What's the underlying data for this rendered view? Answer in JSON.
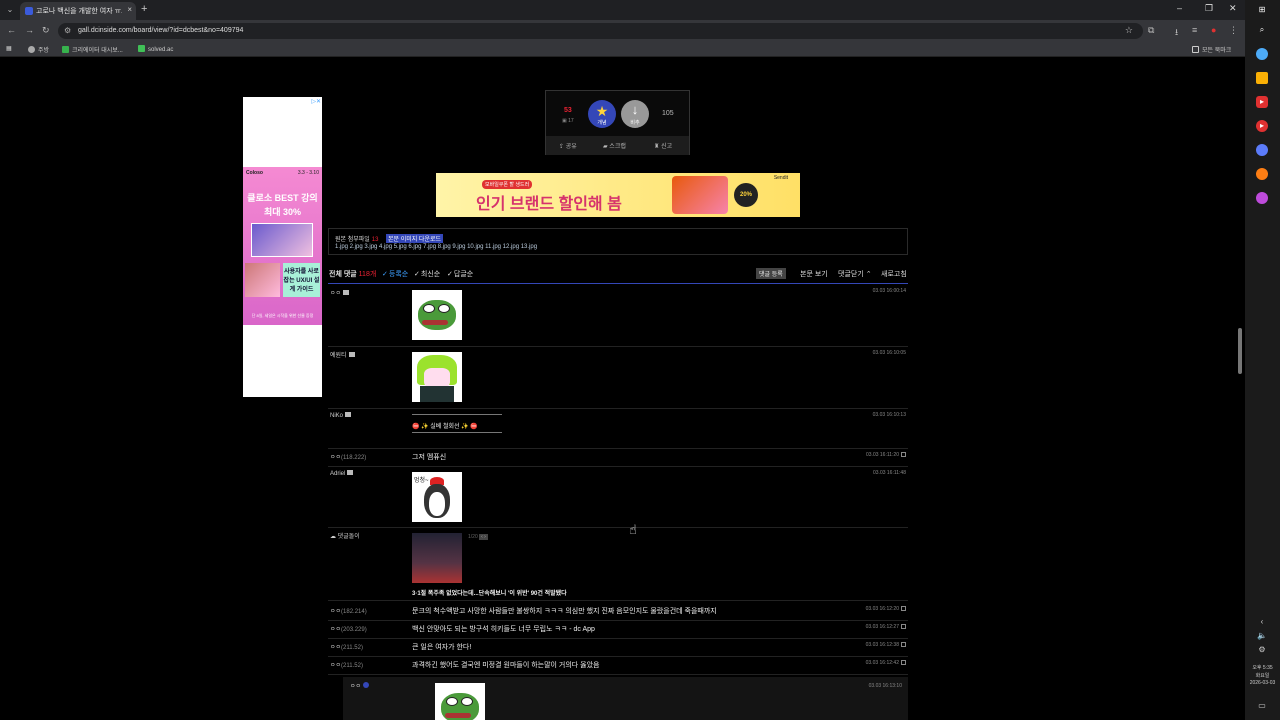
{
  "browser": {
    "tab_title": "고로나 백신을 개발한 여자 ㅠ...",
    "url": "gall.dcinside.com/board/view/?id=dcbest&no=409794",
    "bookmarks": [
      "주방",
      "크리에이터 대시보...",
      "solved.ac"
    ],
    "all_bookmarks": "모든 북마크"
  },
  "sidebar_clock": {
    "time": "오후 5:35",
    "day": "화요일",
    "date": "2026-03-03"
  },
  "side_ad": {
    "brand": "Coloso",
    "dates": "3.3 - 3.10",
    "line1": "클로소 BEST 강의",
    "line2": "최대 30%",
    "box_text": "사용자를 사로잡는 UX/UI 설계 가이드",
    "foot": "단 8일, 세일은 시작을 위한 선물 증정"
  },
  "recommend": {
    "up_count": "53",
    "fixed_count": "17",
    "up_label": "개념",
    "down_label": "비추",
    "down_count": "105",
    "share": "공유",
    "scrap": "스크랩",
    "report": "신고"
  },
  "mid_ad": {
    "tag": "모바일쿠폰 할 생드러",
    "headline": "인기 브랜드 할인해 봄",
    "logo": "Sendit",
    "badge": "20%"
  },
  "files": {
    "label": "원본 첨부파일",
    "count": "13",
    "download": "본문 이미지 다운로드",
    "list": "1.jpg  2.jpg  3.jpg  4.jpg  5.jpg  6.jpg  7.jpg  8.jpg  9.jpg  10.jpg  11.jpg  12.jpg  13.jpg"
  },
  "comments_header": {
    "total_label": "전체 댓글",
    "total_count": "118개",
    "sort_reg": "등록순",
    "sort_new": "최신순",
    "sort_reply": "답글순",
    "register": "댓글 등록",
    "view_body": "본문 보기",
    "close": "댓글닫기",
    "refresh": "새로고침"
  },
  "comments": [
    {
      "nick": "ㅇㅇ",
      "ip": "",
      "date": "03.03 16:00:14"
    },
    {
      "nick": "예원티",
      "ip": "",
      "date": "03.03 16:10:05"
    },
    {
      "nick": "NiKo",
      "ip": "",
      "body": "⛔ ✨ 실베 철회선 ✨ ⛔",
      "date": "03.03 16:10:13"
    },
    {
      "nick": "ㅇㅇ",
      "ip": "(118.222)",
      "body": "그저 멤퓨신",
      "date": "03.03 16:11:20"
    },
    {
      "nick": "Adriel",
      "ip": "",
      "speech": "멍청~",
      "date": "03.03 16:11:48"
    },
    {
      "nick": "댓글돌이",
      "ip": "",
      "pager": "1/20",
      "headline": "3·1절 폭주족 없었다는데...단속해보니 '이 위반' 90건 적발됐다",
      "date": ""
    },
    {
      "nick": "ㅇㅇ",
      "ip": "(182.214)",
      "body": "문크의 척수액받고 사망한 사람들만 불쌍하지 ㅋㅋㅋ 의심만 했지 진짜 음모인지도 물랐을건데 죽을때까지",
      "date": "03.03 16:12:20"
    },
    {
      "nick": "ㅇㅇ",
      "ip": "(203.229)",
      "body": "백신 안맞아도 되는 방구석 히키들도 너무 무립노 ㅋㅋ - dc App",
      "date": "03.03 16:12:27"
    },
    {
      "nick": "ㅇㅇ",
      "ip": "(211.52)",
      "body": "큰 일은 여자가 한다!",
      "date": "03.03 16:12:38"
    },
    {
      "nick": "ㅇㅇ",
      "ip": "(211.52)",
      "body": "과격하긴 했어도 결국엔 미정결 원마들이 하는말이 거의다 옳았음",
      "date": "03.03 16:12:42"
    },
    {
      "nick": "ㅇㅇ",
      "ip": "",
      "date": "03.03 16:13:10"
    }
  ]
}
